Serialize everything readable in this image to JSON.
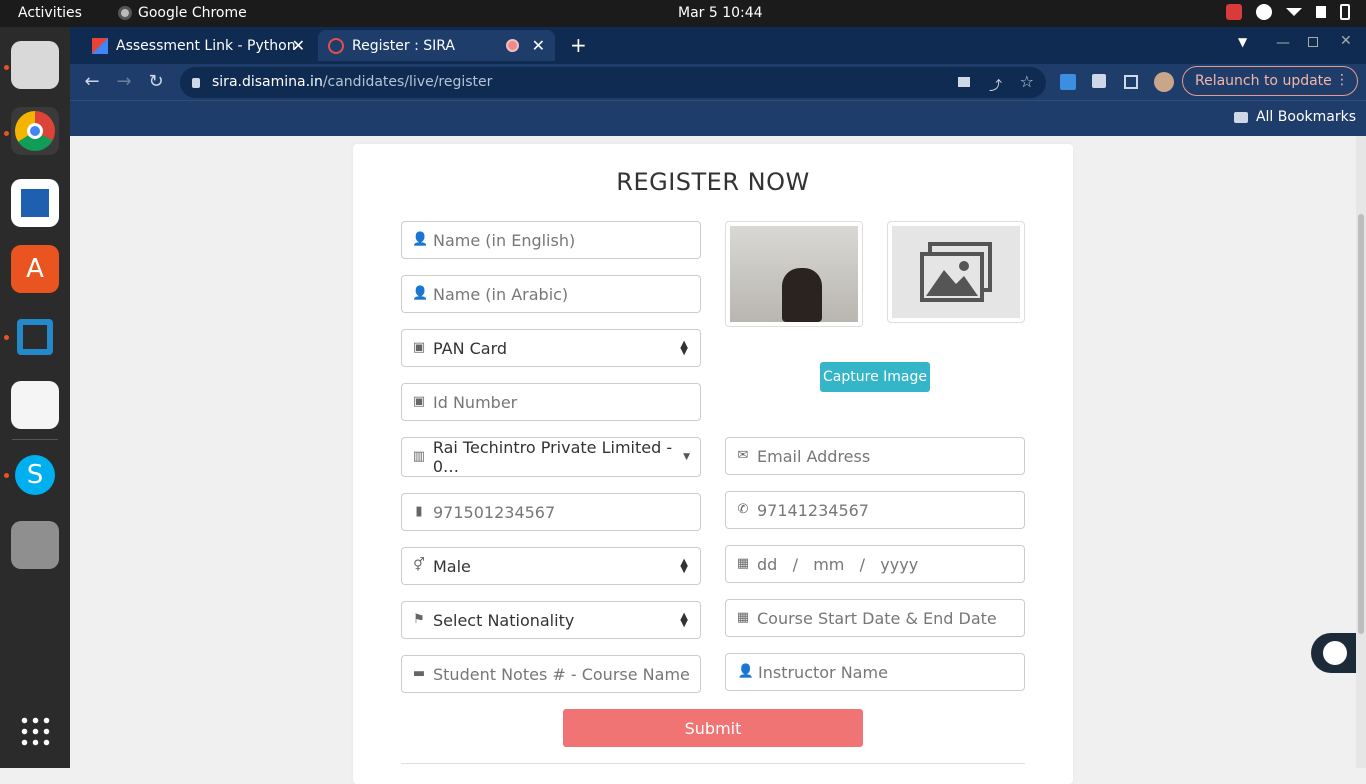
{
  "topbar": {
    "activities": "Activities",
    "app_name": "Google Chrome",
    "clock": "Mar 5  10:44"
  },
  "tabs": [
    {
      "label": "Assessment Link - Python"
    },
    {
      "label": "Register : SIRA"
    }
  ],
  "address": {
    "host": "sira.disamina.in",
    "path": "/candidates/live/register"
  },
  "relaunch_label": "Relaunch to update",
  "bookmarks_label": "All Bookmarks",
  "form": {
    "title": "REGISTER NOW",
    "name_en_placeholder": "Name (in English)",
    "name_ar_placeholder": "Name (in Arabic)",
    "id_type": "PAN Card",
    "id_number_placeholder": "Id Number",
    "company": "Rai Techintro Private Limited - 0…",
    "email_placeholder": "Email Address",
    "mobile_placeholder": "971501234567",
    "phone_placeholder": "97141234567",
    "gender": "Male",
    "dob_placeholder": "dd   /   mm   /   yyyy",
    "nationality": "Select Nationality",
    "course_dates_placeholder": "Course Start Date & End Date",
    "notes_placeholder": "Student Notes # - Course Name",
    "instructor_placeholder": "Instructor Name",
    "capture_label": "Capture Image",
    "submit_label": "Submit"
  },
  "colors": {
    "accent_capture": "#35b6c8",
    "submit": "#f07474",
    "chrome_bar": "#0f2b52"
  }
}
